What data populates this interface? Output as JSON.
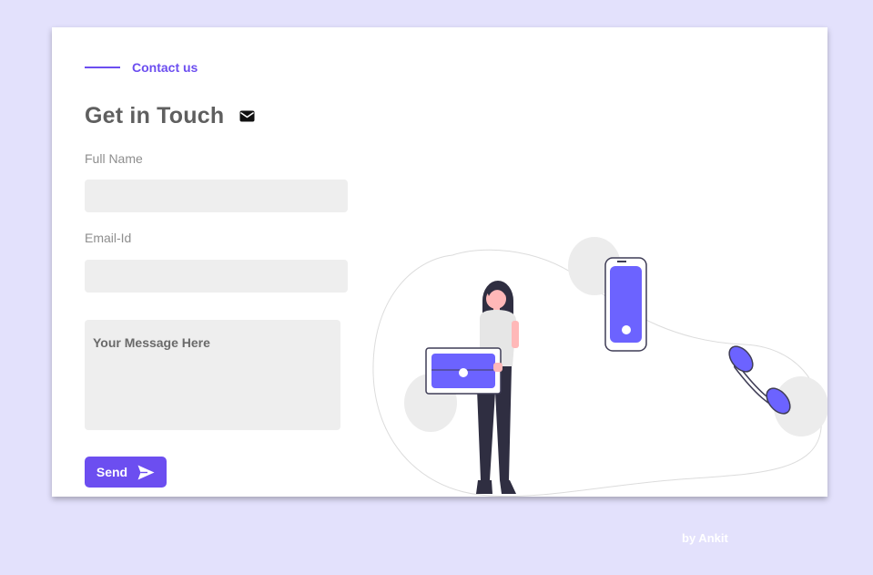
{
  "section": {
    "eyebrow": "Contact us"
  },
  "heading": {
    "title": "Get in Touch",
    "icon": "envelope-icon"
  },
  "form": {
    "full_name_label": "Full Name",
    "full_name_value": "",
    "email_label": "Email-Id",
    "email_value": "",
    "message_placeholder": "Your Message Here",
    "message_value": "",
    "send_label": "Send",
    "send_icon": "paper-plane-icon"
  },
  "footer": {
    "credit": "by Ankit"
  },
  "colors": {
    "accent": "#6c4ef0",
    "page_bg": "#e3e1fc",
    "input_bg": "#eeeeee"
  }
}
